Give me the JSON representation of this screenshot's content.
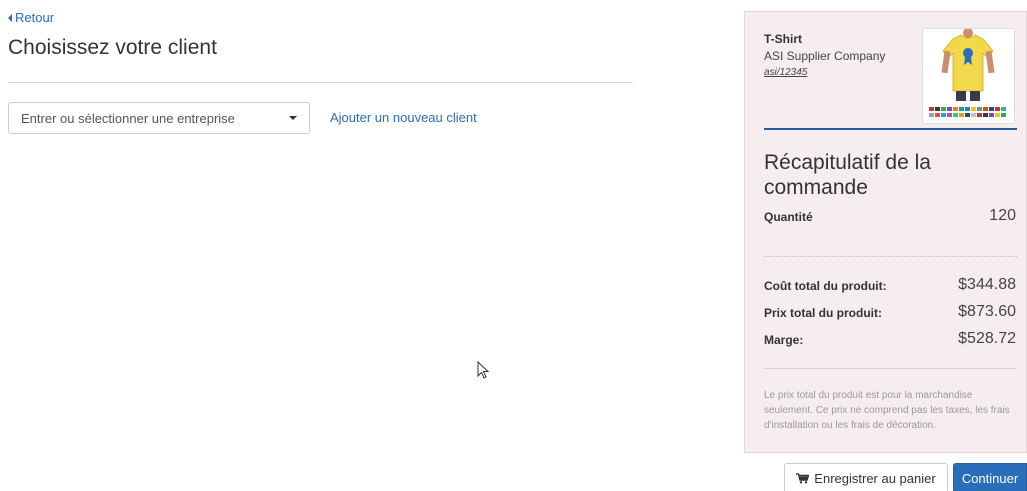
{
  "nav": {
    "back_label": "Retour"
  },
  "page": {
    "title": "Choisissez votre client"
  },
  "client_select": {
    "placeholder": "Entrer ou sélectionner une entreprise",
    "add_link": "Ajouter un nouveau client"
  },
  "product": {
    "name": "T-Shirt",
    "supplier": "ASI Supplier Company",
    "supplier_id": "asi/12345",
    "thumbnail_icon": "tshirt-image",
    "shirt_color": "#f2d84b"
  },
  "summary": {
    "title": "Récapitulatif de la commande",
    "quantity_label": "Quantité",
    "quantity_value": "120",
    "cost_label": "Coût total du produit:",
    "cost_value": "$344.88",
    "price_label": "Prix total du produit:",
    "price_value": "$873.60",
    "margin_label": "Marge:",
    "margin_value": "$528.72",
    "disclaimer": "Le prix total du produit est pour la marchandise seulement. Ce prix ne comprend pas les taxes, les frais d'installation ou les frais de décoration."
  },
  "actions": {
    "save_cart_label": "Enregistrer au panier",
    "continue_label": "Continuer"
  },
  "colors": {
    "accent": "#2a6ebb",
    "panel_bg": "#f6edee",
    "rule_blue": "#2a5a9a"
  }
}
